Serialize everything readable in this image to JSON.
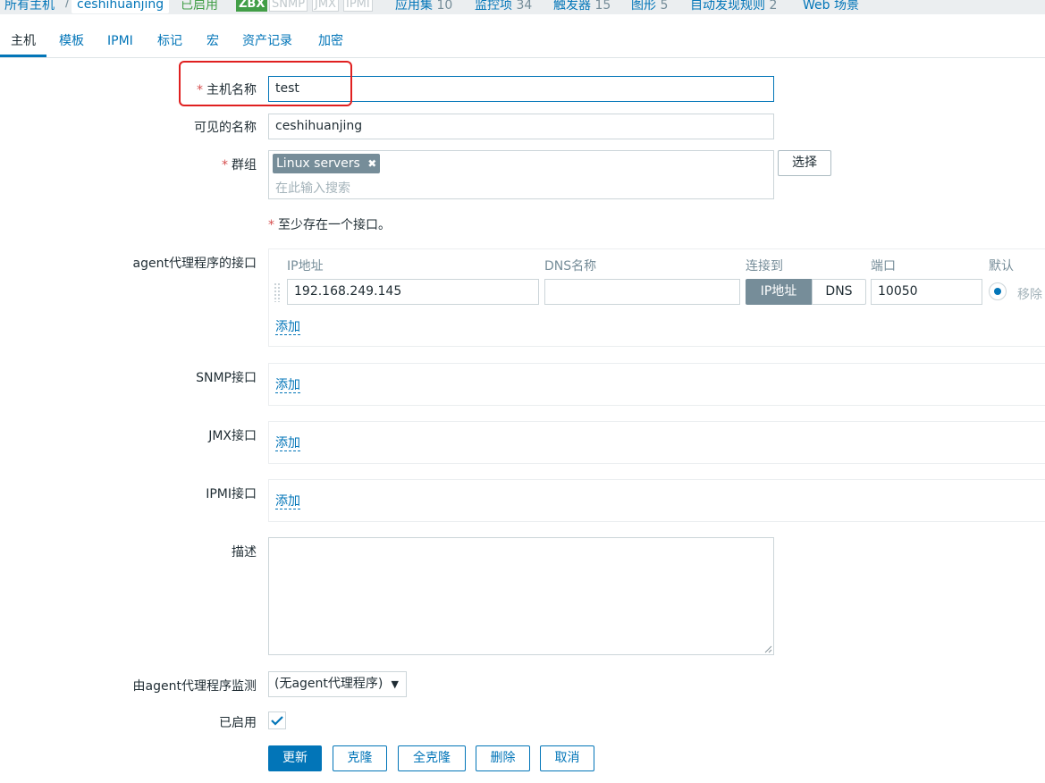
{
  "breadcrumb": {
    "all_hosts": "所有主机",
    "separator": "/",
    "host": "ceshihuanjing",
    "status": "已启用",
    "availability": [
      "ZBX",
      "SNMP",
      "JMX",
      "IPMI"
    ],
    "links": [
      {
        "label": "应用集",
        "count": "10"
      },
      {
        "label": "监控项",
        "count": "34"
      },
      {
        "label": "触发器",
        "count": "15"
      },
      {
        "label": "图形",
        "count": "5"
      },
      {
        "label": "自动发现规则",
        "count": "2"
      },
      {
        "label": "Web 场景",
        "count": ""
      }
    ]
  },
  "tabs": [
    "主机",
    "模板",
    "IPMI",
    "标记",
    "宏",
    "资产记录",
    "加密"
  ],
  "form": {
    "required_mark": "*",
    "host_name_label": "主机名称",
    "host_name_value": "test",
    "visible_name_label": "可见的名称",
    "visible_name_value": "ceshihuanjing",
    "groups_label": "群组",
    "group_tag": "Linux servers",
    "group_tag_remove": "✖",
    "groups_placeholder": "在此输入搜索",
    "select_button": "选择",
    "interface_note": "至少存在一个接口。",
    "agent_interfaces_label": "agent代理程序的接口",
    "columns": {
      "ip": "IP地址",
      "dns": "DNS名称",
      "connect": "连接到",
      "port": "端口",
      "default": "默认"
    },
    "agent_ip": "192.168.249.145",
    "agent_dns": "",
    "connect_ip": "IP地址",
    "connect_dns": "DNS",
    "agent_port": "10050",
    "remove": "移除",
    "add": "添加",
    "snmp_label": "SNMP接口",
    "jmx_label": "JMX接口",
    "ipmi_label": "IPMI接口",
    "description_label": "描述",
    "description_value": "",
    "proxy_label": "由agent代理程序监测",
    "proxy_value": "(无agent代理程序)",
    "enabled_label": "已启用",
    "enabled": true
  },
  "buttons": {
    "update": "更新",
    "clone": "克隆",
    "full_clone": "全克隆",
    "delete": "删除",
    "cancel": "取消"
  },
  "colors": {
    "accent": "#0275b8",
    "highlight_box": "#e02020",
    "success": "#429e47"
  }
}
